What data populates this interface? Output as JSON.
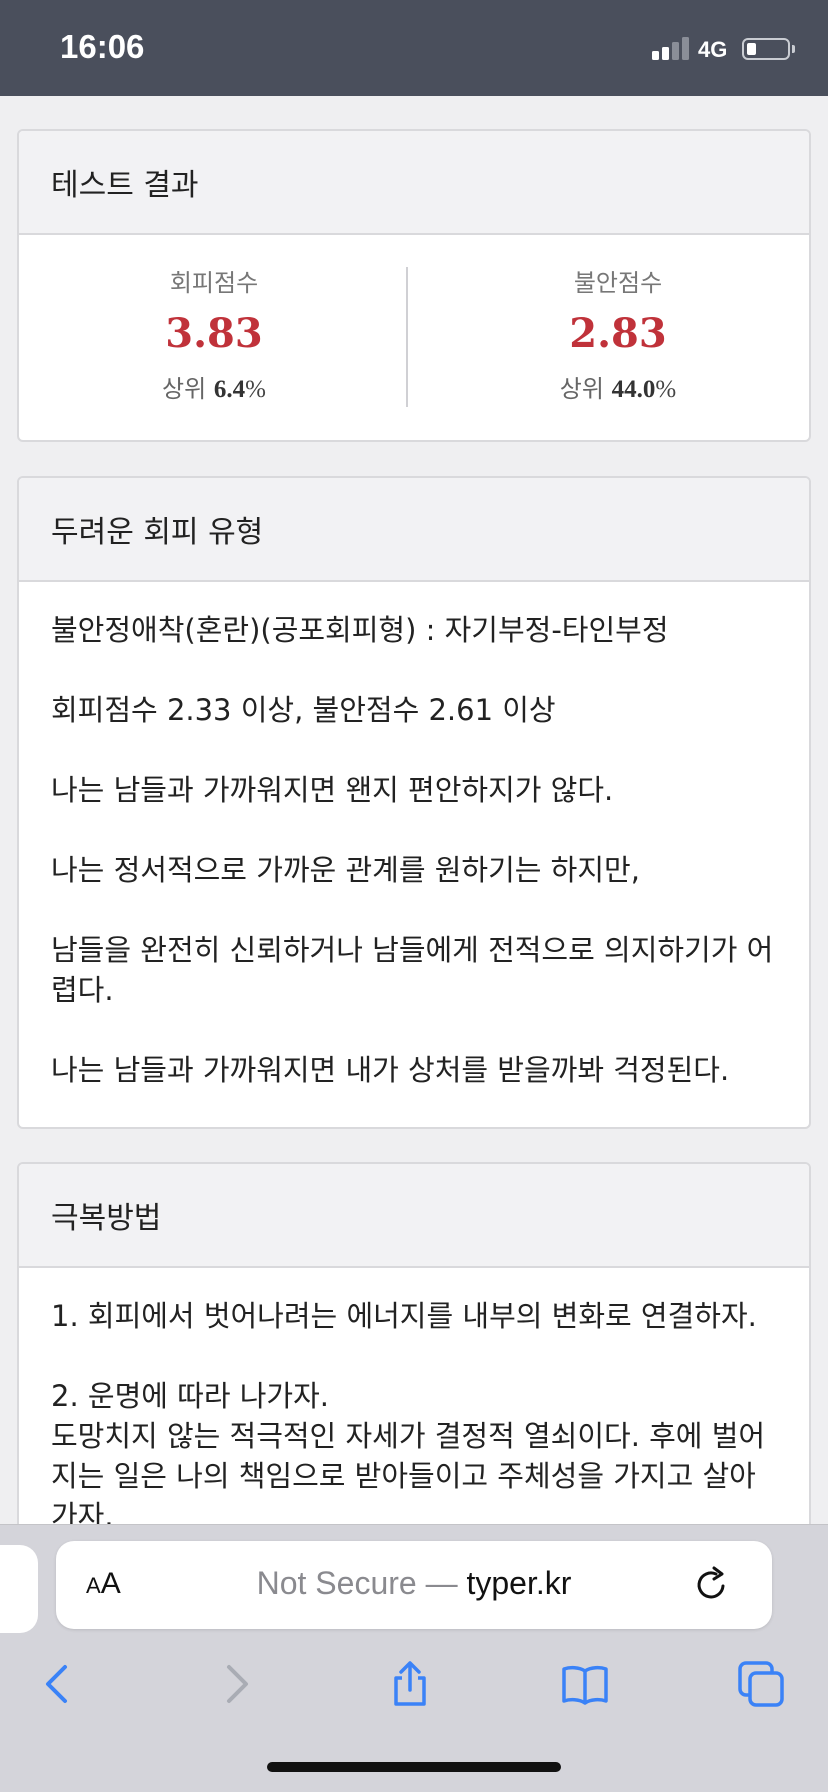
{
  "status_bar": {
    "time": "16:06",
    "network": "4G"
  },
  "result_card": {
    "title": "테스트 결과",
    "avoidance": {
      "label": "회피점수",
      "score": "3.83",
      "rank_prefix": "상위",
      "rank_value": "6.4",
      "rank_unit": "%"
    },
    "anxiety": {
      "label": "불안점수",
      "score": "2.83",
      "rank_prefix": "상위",
      "rank_value": "44.0",
      "rank_unit": "%"
    }
  },
  "type_card": {
    "title": "두려운 회피 유형",
    "paragraphs": [
      "불안정애착(혼란)(공포회피형) : 자기부정-타인부정",
      "회피점수 2.33 이상, 불안점수 2.61 이상",
      "나는 남들과 가까워지면 왠지 편안하지가 않다.",
      "나는 정서적으로 가까운 관계를 원하기는 하지만,",
      "남들을 완전히 신뢰하거나 남들에게 전적으로 의지하기가 어렵다.",
      "나는 남들과 가까워지면 내가 상처를 받을까봐 걱정된다."
    ]
  },
  "solution_card": {
    "title": "극복방법",
    "paragraphs": [
      "1. 회피에서 벗어나려는 에너지를 내부의 변화로 연결하자.",
      "2. 운명에 따라 나가자.",
      "도망치지 않는 적극적인 자세가 결정적 열쇠이다. 후에 벌어지는 일은 나의 책임으로 받아들이고 주체성을 가지고 살아가자."
    ]
  },
  "browser": {
    "aa_label_small": "A",
    "aa_label_big": "A",
    "url_prefix": "Not Secure — ",
    "url_host": "typer.kr"
  },
  "icons": {
    "reload": "reload-icon",
    "back": "back-icon",
    "forward": "forward-icon",
    "share": "share-icon",
    "bookmarks": "bookmarks-icon",
    "tabs": "tabs-icon"
  },
  "colors": {
    "score_accent": "#c0323a",
    "status_bar_bg": "#4a4f5c",
    "toolbar_icon": "#3a82f7"
  }
}
